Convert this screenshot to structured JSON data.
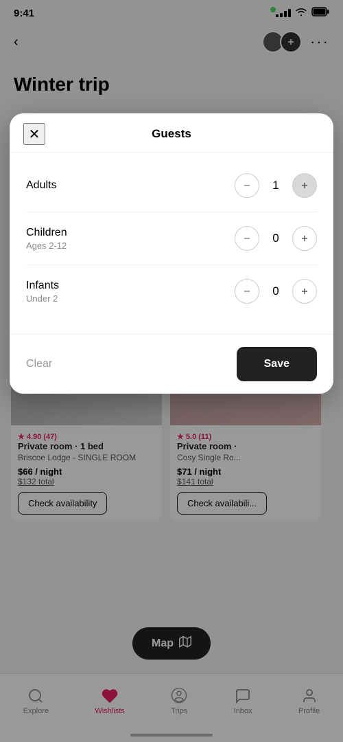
{
  "statusBar": {
    "time": "9:41",
    "signalBars": [
      3,
      5,
      7,
      9
    ],
    "batteryLevel": 100
  },
  "header": {
    "backLabel": "<",
    "title": "Winter trip"
  },
  "modal": {
    "title": "Guests",
    "closeLabel": "✕",
    "rows": [
      {
        "label": "Adults",
        "sublabel": "",
        "value": 1
      },
      {
        "label": "Children",
        "sublabel": "Ages 2-12",
        "value": 0
      },
      {
        "label": "Infants",
        "sublabel": "Under 2",
        "value": 0
      }
    ],
    "clearLabel": "Clear",
    "saveLabel": "Save"
  },
  "cards": [
    {
      "rating": "4.90 (47)",
      "type": "Private room · 1 bed",
      "name": "Briscoe Lodge - SINGLE ROOM",
      "pricePerNight": "$66 / night",
      "totalPrice": "$132 total",
      "checkAvailabilityLabel": "Check availability"
    },
    {
      "rating": "5.0 (11)",
      "type": "Private room ·",
      "name": "Cosy Single Ro",
      "pricePerNight": "$71 / night",
      "totalPrice": "$141 total",
      "checkAvailabilityLabel": "Check availabili"
    }
  ],
  "mapButton": {
    "label": "Map",
    "icon": "map-icon"
  },
  "bottomNav": {
    "items": [
      {
        "label": "Explore",
        "icon": "search-icon",
        "active": false
      },
      {
        "label": "Wishlists",
        "icon": "heart-icon",
        "active": true
      },
      {
        "label": "Trips",
        "icon": "airbnb-icon",
        "active": false
      },
      {
        "label": "Inbox",
        "icon": "chat-icon",
        "active": false
      },
      {
        "label": "Profile",
        "icon": "person-icon",
        "active": false
      }
    ]
  }
}
